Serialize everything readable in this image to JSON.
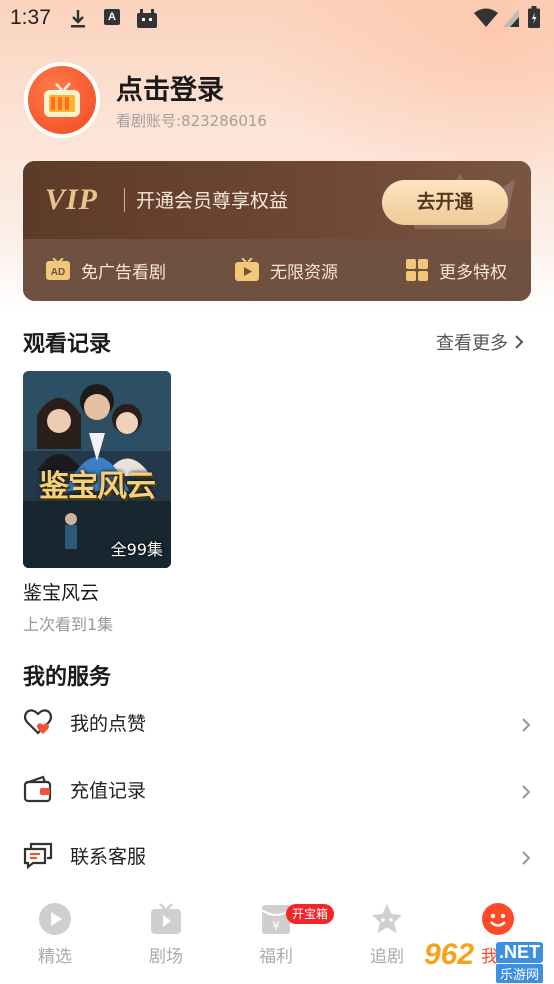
{
  "status_bar": {
    "time": "1:37"
  },
  "profile": {
    "login_text": "点击登录",
    "account_line": "看剧账号:823286016"
  },
  "vip": {
    "logo": "VIP",
    "slogan": "开通会员尊享权益",
    "open_button": "去开通",
    "perks": [
      "免广告看剧",
      "无限资源",
      "更多特权"
    ]
  },
  "history": {
    "title": "观看记录",
    "see_more": "查看更多",
    "item": {
      "poster_art_text": "鉴宝风云",
      "episodes": "全99集",
      "title": "鉴宝风云",
      "progress": "上次看到1集"
    }
  },
  "services": {
    "title": "我的服务",
    "items": [
      "我的点赞",
      "充值记录",
      "联系客服"
    ]
  },
  "bottom_nav": {
    "items": [
      "精选",
      "剧场",
      "福利",
      "追剧",
      "我的"
    ],
    "badge": "开宝箱"
  },
  "watermark": {
    "number": "962",
    "suffix": ".NET",
    "cn": "乐游网"
  },
  "colors": {
    "accent": "#ff4a2a",
    "vip_brown": "#6a4230",
    "vip_gold": "#e9c48f"
  }
}
